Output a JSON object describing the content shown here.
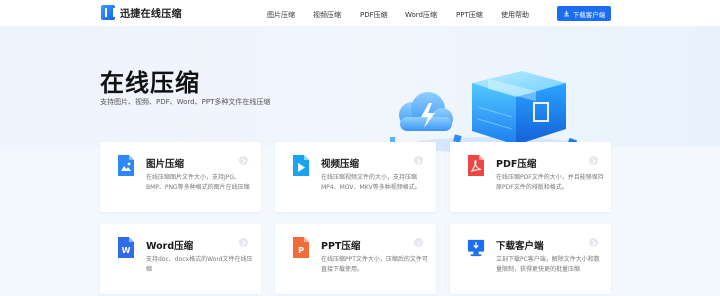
{
  "header": {
    "logo_text": "迅捷在线压缩",
    "nav": [
      "图片压缩",
      "视频压缩",
      "PDF压缩",
      "Word压缩",
      "PPT压缩",
      "使用帮助"
    ],
    "download_button": "下载客户端"
  },
  "hero": {
    "title": "在线压缩",
    "subtitle": "支持图片、视频、PDF、Word、PPT多种文件在线压缩"
  },
  "cards": [
    {
      "title": "图片压缩",
      "desc": "在线压缩图片文件大小，支持JPG、BMP、PNG等多种格式的图片在线压缩",
      "icon": "image-file-icon",
      "color": "#2f86f6"
    },
    {
      "title": "视频压缩",
      "desc": "在线压缩视频文件的大小，支持压缩MP4、MOV、MKV等多种视频格式。",
      "icon": "video-file-icon",
      "color": "#1aa3f0"
    },
    {
      "title": "PDF压缩",
      "desc": "在线压缩PDF文件的大小，并且能够保持原PDF文件的排版和格式。",
      "icon": "pdf-file-icon",
      "color": "#ee4545"
    },
    {
      "title": "Word压缩",
      "desc": "支持doc、docx格式的Word文件在线压缩",
      "icon": "word-file-icon",
      "color": "#2f6de8"
    },
    {
      "title": "PPT压缩",
      "desc": "在线压缩PPT文件大小，压缩后的文件可直接下载使用。",
      "icon": "ppt-file-icon",
      "color": "#f26b3a"
    },
    {
      "title": "下载客户端",
      "desc": "立刻下载PC客户端，解除文件大小和数量限制，获得更快更的批量压缩",
      "icon": "desktop-download-icon",
      "color": "#1b6df2"
    }
  ]
}
